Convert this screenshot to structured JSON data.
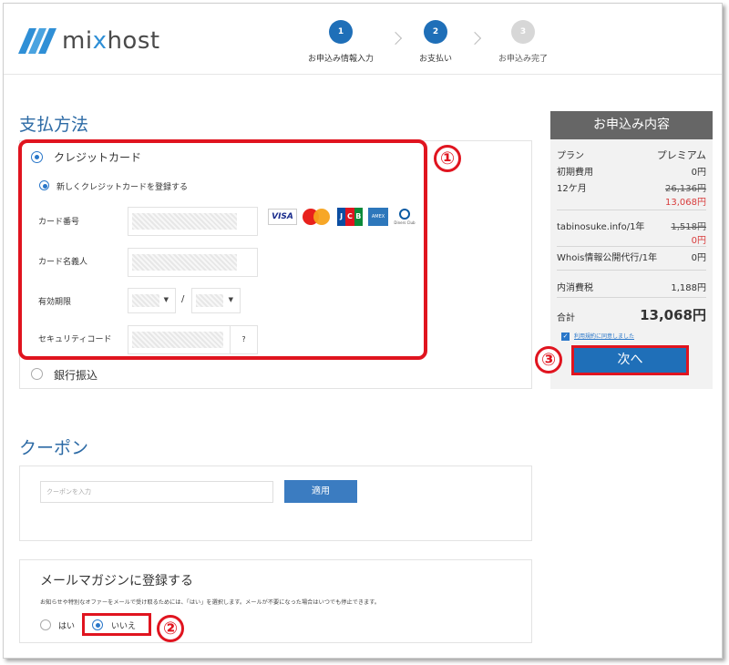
{
  "brand": {
    "logo_text_a": "mi",
    "logo_text_x": "x",
    "logo_text_b": "host"
  },
  "steps": [
    {
      "num": "1",
      "label": "お申込み情報入力",
      "state": "done"
    },
    {
      "num": "2",
      "label": "お支払い",
      "state": "active"
    },
    {
      "num": "3",
      "label": "お申込み完了",
      "state": "inactive"
    }
  ],
  "payment": {
    "title": "支払方法",
    "credit_card_label": "クレジットカード",
    "new_card_label": "新しくクレジットカードを登録する",
    "card_number_label": "カード番号",
    "card_name_label": "カード名義人",
    "expiry_label": "有効期限",
    "expiry_separator": "/",
    "security_code_label": "セキュリティコード",
    "security_help": "?",
    "bank_transfer_label": "銀行振込",
    "card_brands": [
      "VISA",
      "Mastercard",
      "JCB",
      "AMERICAN EXPRESS",
      "Diners Club"
    ],
    "visa_text": "VISA",
    "jcb_letters": [
      "J",
      "C",
      "B"
    ],
    "amex_text": "AMEX",
    "diners_text": "Diners Club"
  },
  "summary": {
    "title": "お申込み内容",
    "rows": [
      {
        "label": "プラン",
        "value": "プレミアム"
      },
      {
        "label": "初期費用",
        "value": "0円"
      },
      {
        "label": "12ケ月",
        "old_value": "26,136円",
        "value": "13,068円"
      },
      {
        "label": "tabinosuke.info/1年",
        "old_value": "1,518円",
        "value": "0円"
      },
      {
        "label": "Whois情報公開代行/1年",
        "value": "0円"
      },
      {
        "label": "内消費税",
        "value": "1,188円"
      }
    ],
    "total_label": "合計",
    "total_value": "13,068円",
    "terms_label": "利用規約に同意しました",
    "terms_checked": true,
    "next_button": "次へ"
  },
  "coupon": {
    "title": "クーポン",
    "placeholder": "クーポンを入力",
    "apply_button": "適用"
  },
  "mail": {
    "title": "メールマガジンに登録する",
    "description": "お知らせや特別なオファーをメールで受け取るためには、「はい」を選択します。メールが不要になった場合はいつでも停止できます。",
    "yes_label": "はい",
    "no_label": "いいえ",
    "selected": "no"
  },
  "annotations": [
    "①",
    "②",
    "③"
  ],
  "colors": {
    "accent": "#1f6fb8",
    "heading": "#2c6aa5",
    "highlight": "#e0141f",
    "sale": "#d83b3b"
  }
}
